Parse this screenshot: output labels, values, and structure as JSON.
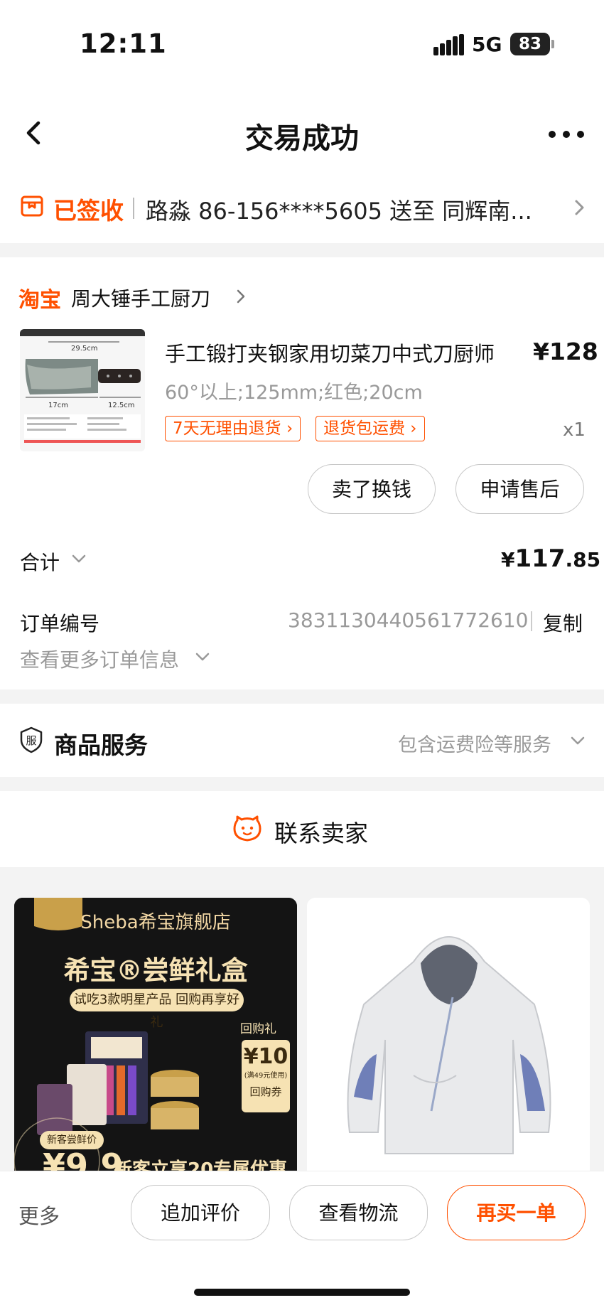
{
  "status_bar": {
    "time": "12:11",
    "network": "5G",
    "battery": "83"
  },
  "nav": {
    "title": "交易成功"
  },
  "delivery": {
    "status": "已签收",
    "address": "路淼 86-156****5605 送至 同辉南..."
  },
  "store": {
    "platform_logo": "淘宝",
    "name": "周大锤手工厨刀"
  },
  "product": {
    "title": "手工锻打夹钢家用切菜刀中式刀厨师",
    "price": "¥128",
    "sku": "60°以上;125mm;红色;20cm",
    "tags": [
      "7天无理由退货",
      "退货包运费"
    ],
    "quantity": "x1",
    "image_text": [
      "29.5cm",
      "17cm",
      "12.5cm"
    ]
  },
  "actions": {
    "sell": "卖了换钱",
    "after_sale": "申请售后"
  },
  "total": {
    "label": "合计",
    "currency": "¥",
    "amount_int": "117",
    "amount_dec": ".85"
  },
  "order": {
    "label": "订单编号",
    "number": "3831130440561772610",
    "copy": "复制",
    "more_info": "查看更多订单信息"
  },
  "service": {
    "icon_text": "服",
    "title": "商品服务",
    "desc": "包含运费险等服务"
  },
  "contact": {
    "label": "联系卖家"
  },
  "recommendations": {
    "ad": {
      "store": "Sheba希宝旗舰店",
      "title": "希宝®尝鲜礼盒",
      "subtitle": "试吃3款明星产品 回购再享好礼",
      "gift_label": "回购礼",
      "coupon_value": "¥10",
      "coupon_note": "(满49元使用)",
      "coupon_label": "回购券",
      "newprice_label": "新客尝鲜价",
      "newprice": "¥9.9",
      "bottom_text": "新客立享20专属优惠"
    }
  },
  "bottom_bar": {
    "more": "更多",
    "review": "追加评价",
    "logistics": "查看物流",
    "rebuy": "再买一单"
  },
  "colors": {
    "accent": "#ff5000",
    "muted": "#999999",
    "ad_gold": "#f6e2b3"
  }
}
